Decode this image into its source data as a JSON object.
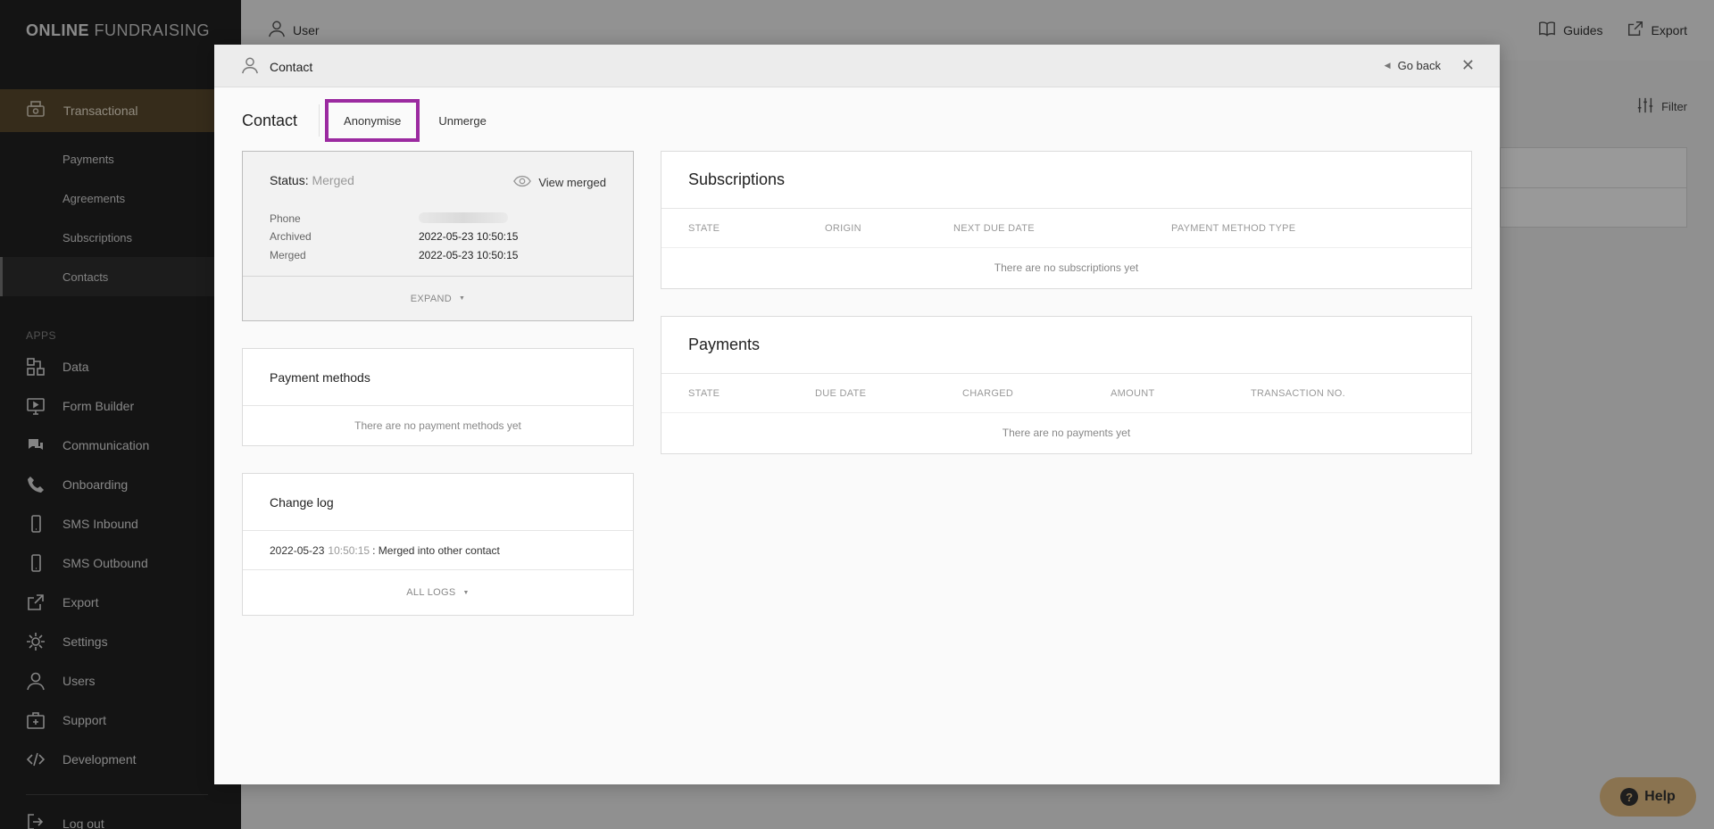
{
  "brand": {
    "bold": "ONLINE",
    "light": "FUNDRAISING"
  },
  "sidebar": {
    "section_active": {
      "label": "Transactional",
      "icon": "register-icon"
    },
    "sub_items": [
      {
        "label": "Payments"
      },
      {
        "label": "Agreements"
      },
      {
        "label": "Subscriptions"
      },
      {
        "label": "Contacts"
      }
    ],
    "apps_heading": "APPS",
    "apps": [
      {
        "label": "Data",
        "icon": "data-icon"
      },
      {
        "label": "Form Builder",
        "icon": "monitor-icon"
      },
      {
        "label": "Communication",
        "icon": "chat-icon"
      },
      {
        "label": "Onboarding",
        "icon": "phone-icon"
      },
      {
        "label": "SMS Inbound",
        "icon": "mobile-icon"
      },
      {
        "label": "SMS Outbound",
        "icon": "mobile-icon"
      },
      {
        "label": "Export",
        "icon": "export-icon"
      },
      {
        "label": "Settings",
        "icon": "gear-icon"
      },
      {
        "label": "Users",
        "icon": "user-icon"
      },
      {
        "label": "Support",
        "icon": "first-aid-icon"
      },
      {
        "label": "Development",
        "icon": "code-icon"
      }
    ],
    "logout": "Log out"
  },
  "topbar": {
    "user": "User",
    "guides": "Guides",
    "export": "Export",
    "filter": "Filter"
  },
  "help": {
    "label": "Help"
  },
  "modal": {
    "title": "Contact",
    "go_back": "Go back",
    "tabs": {
      "main": "Contact",
      "anonymise": "Anonymise",
      "unmerge": "Unmerge"
    },
    "status": {
      "label": "Status:",
      "value": "Merged",
      "view_merged": "View merged",
      "fields": [
        {
          "key": "Phone",
          "value": ""
        },
        {
          "key": "Archived",
          "value": "2022-05-23 10:50:15"
        },
        {
          "key": "Merged",
          "value": "2022-05-23 10:50:15"
        }
      ],
      "expand": "EXPAND"
    },
    "payment_methods": {
      "title": "Payment methods",
      "empty": "There are no payment methods yet"
    },
    "change_log": {
      "title": "Change log",
      "entry_date": "2022-05-23",
      "entry_time": "10:50:15",
      "entry_text": ": Merged into other contact",
      "all_logs": "ALL LOGS"
    },
    "subscriptions": {
      "title": "Subscriptions",
      "columns": [
        "STATE",
        "ORIGIN",
        "NEXT DUE DATE",
        "PAYMENT METHOD TYPE"
      ],
      "empty": "There are no subscriptions yet"
    },
    "payments": {
      "title": "Payments",
      "columns": [
        "STATE",
        "DUE DATE",
        "CHARGED",
        "AMOUNT",
        "TRANSACTION NO."
      ],
      "empty": "There are no payments yet"
    }
  },
  "colors": {
    "sidebar_bg": "#222222",
    "active_section": "#5a4a2e",
    "highlight_border": "#9b2aa0",
    "help_bg": "#8a7350"
  }
}
